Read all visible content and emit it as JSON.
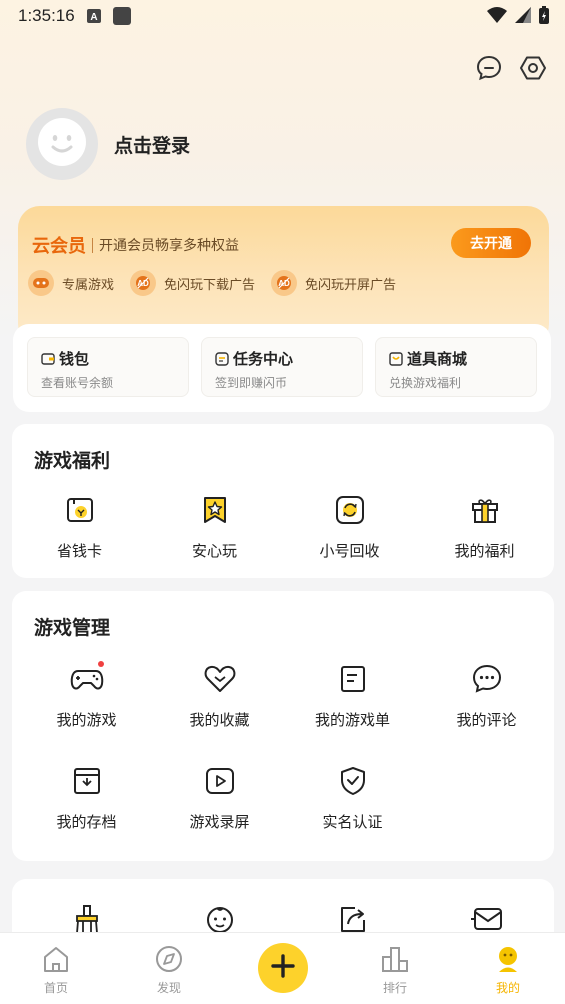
{
  "status_bar": {
    "time": "1:35:16",
    "icons": [
      "a-notification-icon",
      "square-notification-icon",
      "wifi-icon",
      "signal-icon",
      "battery-charging-icon"
    ]
  },
  "header": {
    "icons": [
      "message-icon",
      "settings-icon"
    ]
  },
  "profile": {
    "login_text": "点击登录",
    "avatar_icon": "face-icon"
  },
  "vip": {
    "logo": "云会员",
    "description": "开通会员畅享多种权益",
    "button": "去开通",
    "perks": [
      {
        "label": "专属游戏",
        "icon": "gamepad-icon"
      },
      {
        "label": "免闪玩下载广告",
        "icon": "no-ad-icon"
      },
      {
        "label": "免闪玩开屏广告",
        "icon": "no-ad-icon"
      }
    ],
    "accent_color": "#e8670c"
  },
  "quick": [
    {
      "title": "钱包",
      "subtitle": "查看账号余额",
      "icon": "wallet-icon"
    },
    {
      "title": "任务中心",
      "subtitle": "签到即赚闪币",
      "icon": "task-icon"
    },
    {
      "title": "道具商城",
      "subtitle": "兑换游戏福利",
      "icon": "shop-icon"
    }
  ],
  "welfare": {
    "title": "游戏福利",
    "items": [
      {
        "label": "省钱卡",
        "icon": "savings-card-icon"
      },
      {
        "label": "安心玩",
        "icon": "star-bookmark-icon"
      },
      {
        "label": "小号回收",
        "icon": "recycle-icon"
      },
      {
        "label": "我的福利",
        "icon": "gift-icon"
      }
    ]
  },
  "manage": {
    "title": "游戏管理",
    "items": [
      {
        "label": "我的游戏",
        "icon": "gamepad-icon"
      },
      {
        "label": "我的收藏",
        "icon": "heart-icon"
      },
      {
        "label": "我的游戏单",
        "icon": "list-doc-icon"
      },
      {
        "label": "我的评论",
        "icon": "comment-icon"
      },
      {
        "label": "我的存档",
        "icon": "archive-icon"
      },
      {
        "label": "游戏录屏",
        "icon": "video-play-icon"
      },
      {
        "label": "实名认证",
        "icon": "shield-check-icon"
      }
    ]
  },
  "more": {
    "items": [
      {
        "icon": "clean-brush-icon"
      },
      {
        "icon": "baby-face-icon"
      },
      {
        "icon": "share-icon"
      },
      {
        "icon": "mail-icon"
      }
    ]
  },
  "bottom_nav": {
    "items": [
      {
        "label": "首页",
        "icon": "home-icon",
        "active": false
      },
      {
        "label": "发现",
        "icon": "compass-icon",
        "active": false
      },
      {
        "label": "排行",
        "icon": "ranking-icon",
        "active": false
      },
      {
        "label": "我的",
        "icon": "mine-icon",
        "active": true
      }
    ],
    "plus_icon": "plus-icon",
    "active_color": "#f5b400"
  }
}
